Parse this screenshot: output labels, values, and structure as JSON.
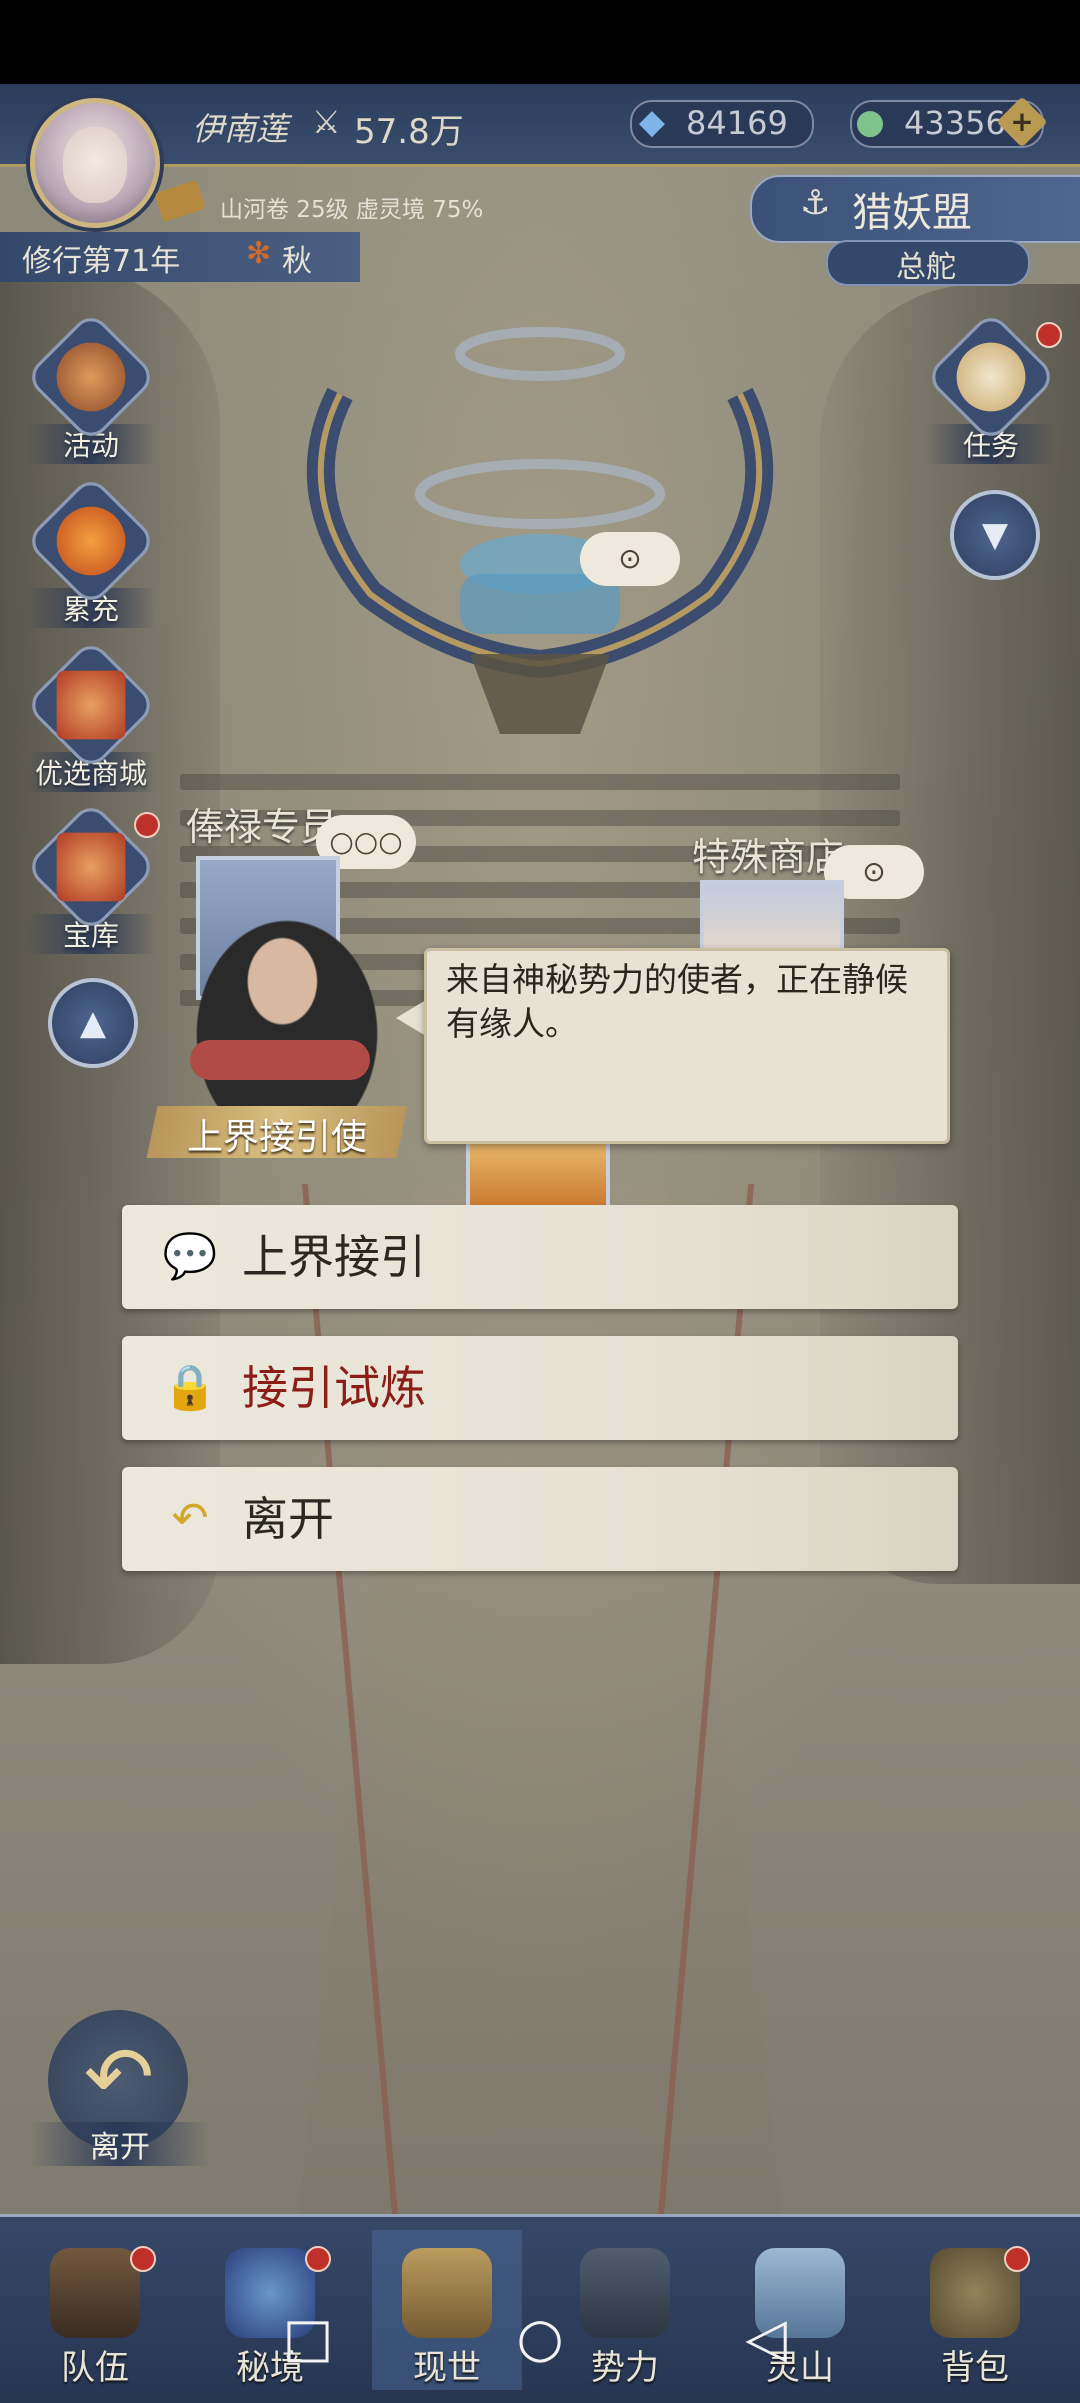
{
  "header": {
    "player_name": "伊南莲",
    "power": "57.8万",
    "crystal": "84169",
    "jade": "43356",
    "realm_info": "山河卷 25级 虚灵境 75%",
    "year": "修行第71年",
    "season": "秋"
  },
  "faction": {
    "name": "猎妖盟",
    "sub": "总舵"
  },
  "side_menu": {
    "activity": "活动",
    "recharge": "累充",
    "shop": "优选商城",
    "treasury": "宝库",
    "task": "任务"
  },
  "scene": {
    "sign_salary": "俸禄专员",
    "sign_shop": "特殊商店",
    "bubble_dots": "○○○",
    "coin_icon": "coin-icon"
  },
  "npc": {
    "name": "上界接引使",
    "dialog": "来自神秘势力的使者，正在静候有缘人。"
  },
  "options": [
    {
      "label": "上界接引",
      "icon": "chat-bubble-icon"
    },
    {
      "label": "接引试炼",
      "icon": "lock-icon"
    },
    {
      "label": "离开",
      "icon": "return-arrow-icon"
    }
  ],
  "back_label": "离开",
  "bottom_nav": [
    "队伍",
    "秘境",
    "现世",
    "势力",
    "灵山",
    "背包"
  ],
  "colors": {
    "accent_gold": "#b99a52",
    "hud_blue": "#34486b",
    "option_red": "#8c1e18"
  }
}
